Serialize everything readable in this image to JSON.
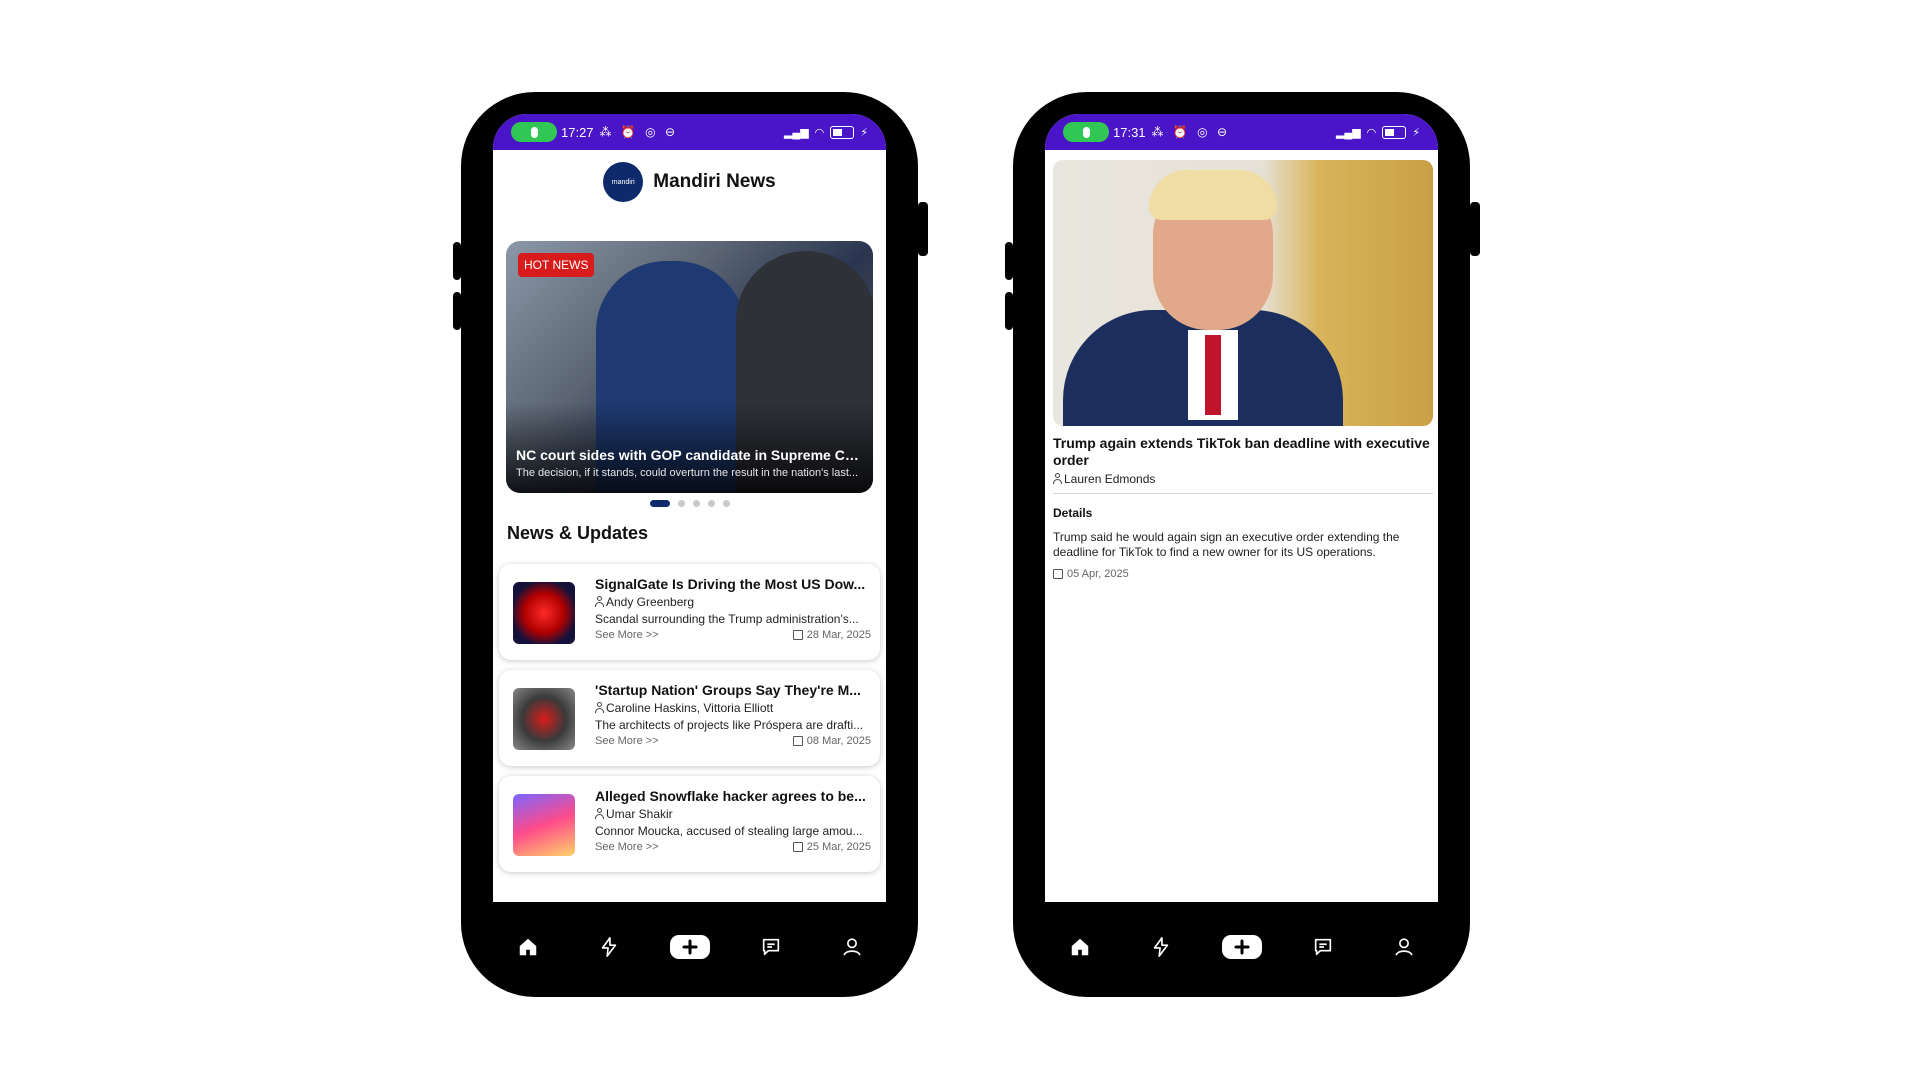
{
  "colors": {
    "status_bar": "#4a14c8",
    "hot_badge": "#d81b1b",
    "accent_navy": "#0e2a6b",
    "phone_frame": "#000000"
  },
  "left_phone": {
    "status": {
      "time": "17:27",
      "icons": "⁂ ⏰ ◎ ⊖"
    },
    "header": {
      "logo_text": "mandiri",
      "title": "Mandiri News"
    },
    "hero": {
      "badge": "HOT NEWS",
      "title": "NC court sides with GOP candidate in Supreme Cou...",
      "subtitle": "The decision, if it stands, could overturn the result in the nation's last...",
      "slide_count": 5,
      "active_slide": 1
    },
    "section_title": "News & Updates",
    "news": [
      {
        "title": "SignalGate Is Driving the Most US Dow...",
        "author": "Andy Greenberg",
        "desc": "Scandal surrounding the Trump administration's...",
        "more": "See More >>",
        "date": "28 Mar, 2025"
      },
      {
        "title": "'Startup Nation' Groups Say They're M...",
        "author": "Caroline Haskins, Vittoria Elliott",
        "desc": "The architects of projects like Próspera are drafti...",
        "more": "See More >>",
        "date": "08 Mar, 2025"
      },
      {
        "title": "Alleged Snowflake hacker agrees to be...",
        "author": "Umar Shakir",
        "desc": "Connor Moucka, accused of stealing large amou...",
        "more": "See More >>",
        "date": "25 Mar, 2025"
      }
    ]
  },
  "right_phone": {
    "status": {
      "time": "17:31",
      "icons": "⁂ ⏰ ◎ ⊖"
    },
    "article": {
      "title": "Trump again extends TikTok ban deadline with executive order",
      "author": "Lauren Edmonds",
      "details_label": "Details",
      "details": "Trump said he would again sign an executive order extending the deadline for TikTok to find a new owner for its US operations.",
      "date": "05 Apr, 2025"
    }
  },
  "nav": {
    "items": [
      "home-icon",
      "bolt-icon",
      "add-icon",
      "chat-icon",
      "profile-icon"
    ]
  }
}
